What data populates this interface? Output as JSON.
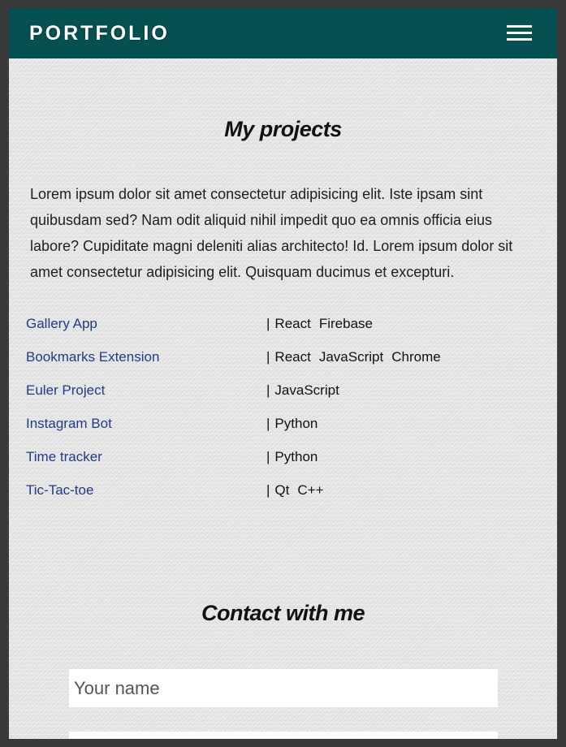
{
  "header": {
    "brand": "PORTFOLIO",
    "menu_icon": "hamburger-menu-icon",
    "background": "#055050"
  },
  "projects": {
    "title": "My projects",
    "intro": "Lorem ipsum dolor sit amet consectetur adipisicing elit. Iste ipsam sint quibusdam sed? Nam odit aliquid nihil impedit quo ea omnis officia eius labore? Cupiditate magni deleniti alias architecto! Id. Lorem ipsum dolor sit amet consectetur adipisicing elit. Quisquam ducimus et excepturi.",
    "separator": "|",
    "items": [
      {
        "name": "Gallery App",
        "techs": [
          "React",
          "Firebase"
        ]
      },
      {
        "name": "Bookmarks Extension",
        "techs": [
          "React",
          "JavaScript",
          "Chrome"
        ]
      },
      {
        "name": "Euler Project",
        "techs": [
          "JavaScript"
        ]
      },
      {
        "name": "Instagram Bot",
        "techs": [
          "Python"
        ]
      },
      {
        "name": "Time tracker",
        "techs": [
          "Python"
        ]
      },
      {
        "name": "Tic-Tac-toe",
        "techs": [
          "Qt",
          "C++"
        ]
      }
    ]
  },
  "contact": {
    "title": "Contact with me",
    "name_placeholder": "Your name"
  },
  "colors": {
    "link": "#223a8a"
  }
}
